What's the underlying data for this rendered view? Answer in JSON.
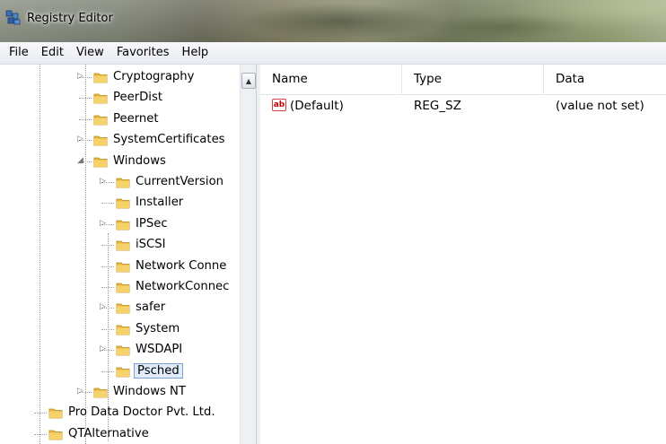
{
  "window": {
    "title": "Registry Editor"
  },
  "menu": [
    "File",
    "Edit",
    "View",
    "Favorites",
    "Help"
  ],
  "tree": [
    {
      "label": "Cryptography",
      "expander": "collapsed"
    },
    {
      "label": "PeerDist",
      "expander": "none"
    },
    {
      "label": "Peernet",
      "expander": "none"
    },
    {
      "label": "SystemCertificates",
      "expander": "collapsed"
    },
    {
      "label": "Windows",
      "expander": "expanded"
    },
    {
      "label": "CurrentVersion",
      "expander": "collapsed"
    },
    {
      "label": "Installer",
      "expander": "none"
    },
    {
      "label": "IPSec",
      "expander": "collapsed"
    },
    {
      "label": "iSCSI",
      "expander": "none"
    },
    {
      "label": "Network Conne",
      "expander": "none"
    },
    {
      "label": "NetworkConnec",
      "expander": "none"
    },
    {
      "label": "safer",
      "expander": "collapsed"
    },
    {
      "label": "System",
      "expander": "none"
    },
    {
      "label": "WSDAPI",
      "expander": "collapsed"
    },
    {
      "label": "Psched",
      "expander": "none",
      "selected": true
    },
    {
      "label": "Windows NT",
      "expander": "collapsed"
    },
    {
      "label": "Pro Data Doctor Pvt. Ltd.",
      "expander": "none"
    },
    {
      "label": "QTAlternative",
      "expander": "none"
    }
  ],
  "list": {
    "columns": [
      "Name",
      "Type",
      "Data"
    ],
    "rows": [
      {
        "icon": "string-value-icon",
        "name": "(Default)",
        "type": "REG_SZ",
        "data": "(value not set)"
      }
    ]
  },
  "colors": {
    "selection_fill": "#e0ecfb",
    "selection_border": "#7da2ce",
    "folder": "#e8b93a"
  }
}
